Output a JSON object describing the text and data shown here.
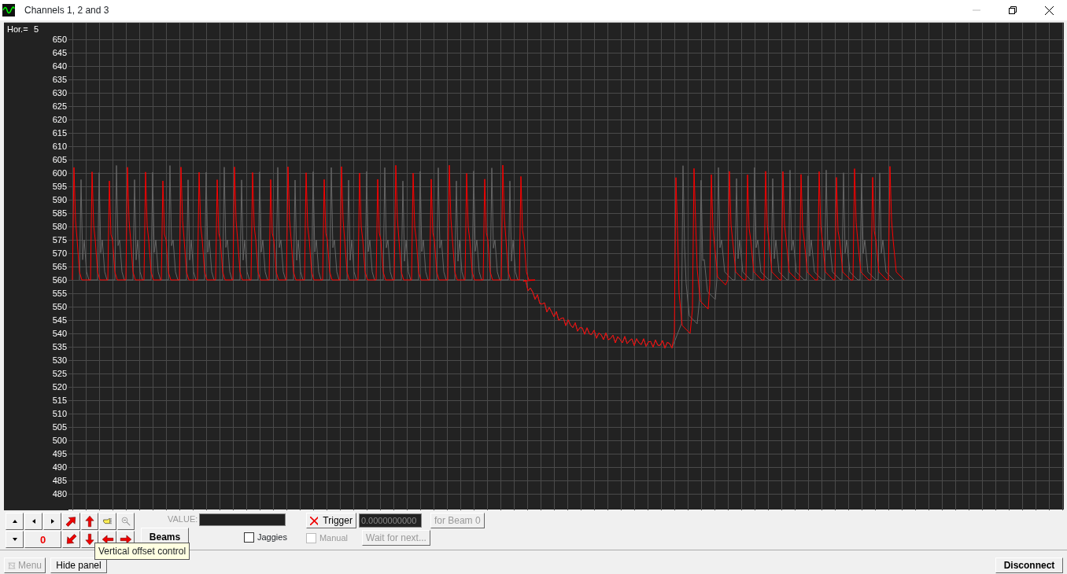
{
  "window": {
    "title": "Channels 1, 2 and 3"
  },
  "plot": {
    "hor_label": "Hor.=",
    "hor_value": "5",
    "y_labels": [
      "650",
      "645",
      "640",
      "635",
      "630",
      "625",
      "620",
      "615",
      "610",
      "605",
      "600",
      "595",
      "590",
      "585",
      "580",
      "575",
      "570",
      "565",
      "560",
      "555",
      "550",
      "545",
      "540",
      "535",
      "530",
      "525",
      "520",
      "515",
      "510",
      "505",
      "500",
      "495",
      "490",
      "485",
      "480"
    ]
  },
  "panel": {
    "counter": "0",
    "value_label": "VALUE:",
    "beams_button": "Beams",
    "jaggies": {
      "label": "Jaggies",
      "checked": false,
      "disabled": false
    },
    "trigger_button": "Trigger",
    "trigger_field": "0.0000000000",
    "for_beam_button": {
      "label": "for Beam 0",
      "disabled": true
    },
    "manual": {
      "label": "Manual",
      "checked": false,
      "disabled": true
    },
    "wait_button": {
      "label": "Wait for next...",
      "disabled": true
    },
    "tooltip": "Vertical offset control"
  },
  "bottom_bar": {
    "menu_button": {
      "label": "Menu",
      "disabled": true
    },
    "hide_panel_button": "Hide panel",
    "disconnect_button": "Disconnect"
  }
}
